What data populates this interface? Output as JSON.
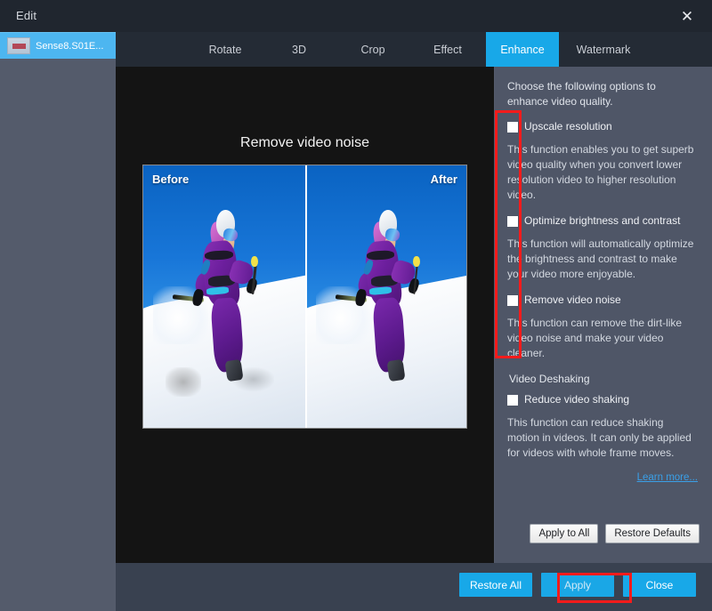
{
  "window": {
    "title": "Edit",
    "close_icon": "close-icon"
  },
  "tabs": [
    {
      "label": "Rotate",
      "active": false
    },
    {
      "label": "3D",
      "active": false
    },
    {
      "label": "Crop",
      "active": false
    },
    {
      "label": "Effect",
      "active": false
    },
    {
      "label": "Enhance",
      "active": true
    },
    {
      "label": "Watermark",
      "active": false
    }
  ],
  "sidebar": {
    "file": {
      "name": "Sense8.S01E...",
      "thumbnail_icon": "video-thumbnail-icon",
      "selected": true
    }
  },
  "preview": {
    "title": "Remove video noise",
    "before_label": "Before",
    "after_label": "After"
  },
  "options": {
    "intro": "Choose the following options to enhance video quality.",
    "items": [
      {
        "label": "Upscale resolution",
        "checked": false,
        "description": "This function enables you to get superb video quality when you convert lower resolution video to higher resolution video."
      },
      {
        "label": "Optimize brightness and contrast",
        "checked": false,
        "description": "This function will automatically optimize the brightness and contrast to make your video more enjoyable."
      },
      {
        "label": "Remove video noise",
        "checked": false,
        "description": "This function can remove the dirt-like video noise and make your video cleaner."
      }
    ],
    "deshaking": {
      "section_title": "Video Deshaking",
      "label": "Reduce video shaking",
      "checked": false,
      "description": "This function can reduce shaking motion in videos. It can only be applied for videos with whole frame moves."
    },
    "learn_more": "Learn more...",
    "apply_to_all": "Apply to All",
    "restore_defaults": "Restore Defaults"
  },
  "footer": {
    "restore_all": "Restore All",
    "apply": "Apply",
    "close": "Close"
  },
  "colors": {
    "accent_blue": "#18a8e8",
    "panel_bg": "#4f5667",
    "sidebar_bg": "#545b6b",
    "titlebar_bg": "#20262f",
    "tabbar_bg": "#242b35",
    "preview_bg": "#141414",
    "annotation_red": "#f51b1b",
    "link_blue": "#3aa0e8"
  }
}
